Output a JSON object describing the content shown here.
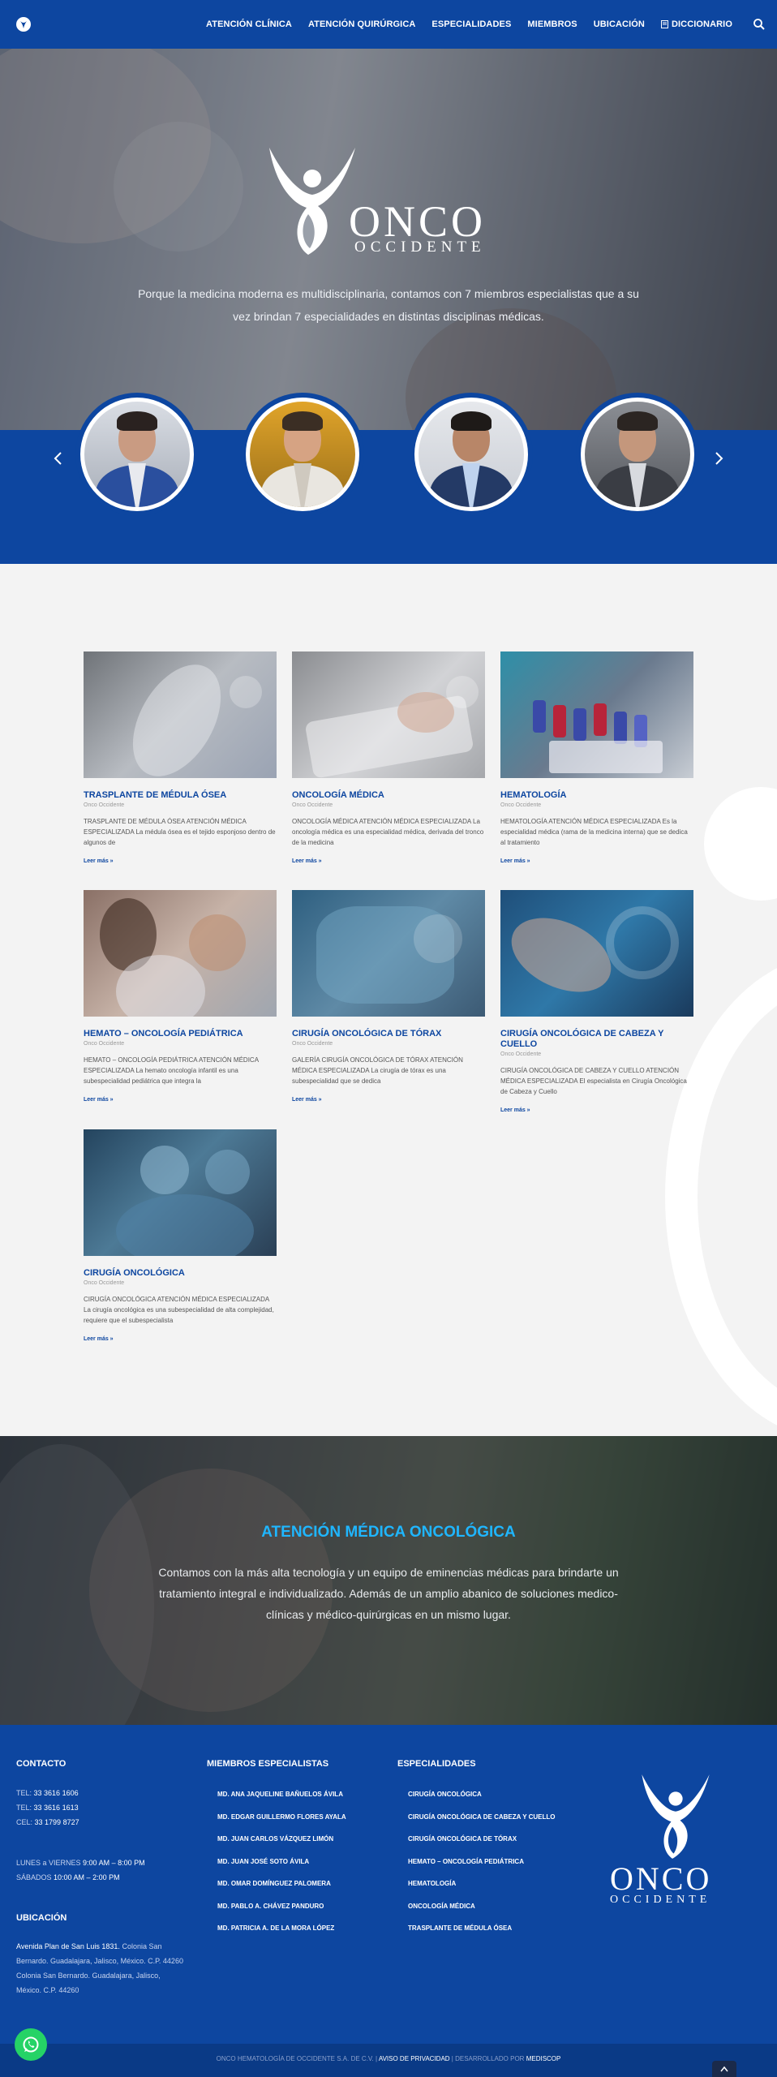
{
  "nav": {
    "items": [
      {
        "label": "ATENCIÓN CLÍNICA"
      },
      {
        "label": "ATENCIÓN QUIRÚRGICA"
      },
      {
        "label": "ESPECIALIDADES"
      },
      {
        "label": "MIEMBROS"
      },
      {
        "label": "UBICACIÓN"
      },
      {
        "label": "DICCIONARIO"
      }
    ],
    "search_icon": "search-icon",
    "dictionary_icon": "book-icon"
  },
  "hero": {
    "brand_word": "ONCO",
    "brand_sub": "OCCIDENTE",
    "text": "Porque la medicina moderna es multidisciplinaria, contamos con 7 miembros especialistas que a su vez brindan 7 especialidades en distintas disciplinas médicas."
  },
  "specialties": [
    {
      "title": "TRASPLANTE DE MÉDULA ÓSEA",
      "meta": "Onco Occidente",
      "excerpt": "TRASPLANTE DE MÉDULA ÓSEA ATENCIÓN MÉDICA ESPECIALIZADA La médula ósea es el tejido esponjoso dentro de algunos de",
      "more": "Leer más »"
    },
    {
      "title": "ONCOLOGÍA MÉDICA",
      "meta": "Onco Occidente",
      "excerpt": "ONCOLOGÍA MÉDICA ATENCIÓN MÉDICA ESPECIALIZADA La oncología médica es una especialidad médica, derivada del tronco de la medicina",
      "more": "Leer más »"
    },
    {
      "title": "HEMATOLOGÍA",
      "meta": "Onco Occidente",
      "excerpt": "HEMATOLOGÍA ATENCIÓN MÉDICA ESPECIALIZADA Es la especialidad médica (rama de la medicina interna) que se dedica al tratamiento",
      "more": "Leer más »"
    },
    {
      "title": "HEMATO – ONCOLOGÍA PEDIÁTRICA",
      "meta": "Onco Occidente",
      "excerpt": "HEMATO – ONCOLOGÍA PEDIÁTRICA ATENCIÓN MÉDICA ESPECIALIZADA La hemato oncología infantil es una subespecialidad pediátrica que integra la",
      "more": "Leer más »"
    },
    {
      "title": "CIRUGÍA ONCOLÓGICA DE TÓRAX",
      "meta": "Onco Occidente",
      "excerpt": "GALERÍA CIRUGÍA ONCOLÓGICA DE TÓRAX ATENCIÓN MÉDICA ESPECIALIZADA La cirugía de tórax es una subespecialidad que se dedica",
      "more": "Leer más »"
    },
    {
      "title": "CIRUGÍA ONCOLÓGICA DE CABEZA Y CUELLO",
      "meta": "Onco Occidente",
      "excerpt": "CIRUGÍA ONCOLÓGICA DE CABEZA Y CUELLO ATENCIÓN MÉDICA ESPECIALIZADA El especialista en Cirugía Oncológica de Cabeza y Cuello",
      "more": "Leer más »"
    },
    {
      "title": "CIRUGÍA ONCOLÓGICA",
      "meta": "Onco Occidente",
      "excerpt": "CIRUGÍA ONCOLÓGICA ATENCIÓN MÉDICA ESPECIALIZADA La cirugía oncológica es una subespecialidad de alta complejidad, requiere que el subespecialista",
      "more": "Leer más »"
    }
  ],
  "banner": {
    "title": "ATENCIÓN MÉDICA ONCOLÓGICA",
    "text": "Contamos con la más alta tecnología y un equipo de eminencias médicas para brindarte un tratamiento integral e individualizado. Además de un amplio abanico de soluciones medico-clínicas y médico-quirúrgicas en un mismo lugar."
  },
  "footer": {
    "contact_heading": "CONTACTO",
    "phones": [
      {
        "label": "TEL:",
        "value": "33 3616 1606"
      },
      {
        "label": "TEL:",
        "value": "33 3616 1613"
      },
      {
        "label": "CEL:",
        "value": "33 1799 8727"
      }
    ],
    "hours": [
      {
        "label": "LUNES a VIERNES",
        "value": "9:00 AM – 8:00 PM"
      },
      {
        "label": "SÁBADOS",
        "value": "10:00 AM – 2:00 PM"
      }
    ],
    "location_heading": "UBICACIÓN",
    "address_strong": "Avenida Plan de San Luis 1831.",
    "address_lines": [
      "Colonia San",
      "Bernardo. Guadalajara, Jalisco, México. C.P. 44260",
      "Colonia San Bernardo. Guadalajara, Jalisco,",
      "México. C.P. 44260"
    ],
    "members_heading": "MIEMBROS ESPECIALISTAS",
    "members": [
      "MD. ANA JAQUELINE BAÑUELOS ÁVILA",
      "MD. EDGAR GUILLERMO FLORES AYALA",
      "MD. JUAN CARLOS VÁZQUEZ LIMÓN",
      "MD. JUAN JOSÉ SOTO ÁVILA",
      "MD. OMAR DOMÍNGUEZ PALOMERA",
      "MD. PABLO A. CHÁVEZ PANDURO",
      "MD. PATRICIA A. DE LA MORA LÓPEZ"
    ],
    "specialties_heading": "ESPECIALIDADES",
    "specialties": [
      "CIRUGÍA ONCOLÓGICA",
      "CIRUGÍA ONCOLÓGICA DE CABEZA Y CUELLO",
      "CIRUGÍA ONCOLÓGICA DE TÓRAX",
      "HEMATO – ONCOLOGÍA PEDIÁTRICA",
      "HEMATOLOGÍA",
      "ONCOLOGÍA MÉDICA",
      "TRASPLANTE DE MÉDULA ÓSEA"
    ],
    "logo_word": "ONCO",
    "logo_sub": "OCCIDENTE"
  },
  "bottom": {
    "company": "ONCO HEMATOLOGÍA DE OCCIDENTE S.A. DE C.V. |",
    "privacy": "AVISO DE PRIVACIDAD",
    "dev_prefix": "| DESARROLLADO POR",
    "dev": "MEDISCOP"
  },
  "colors": {
    "brand_blue": "#0d46a0",
    "accent_cyan": "#1fb6ff",
    "whatsapp_green": "#25d366"
  }
}
